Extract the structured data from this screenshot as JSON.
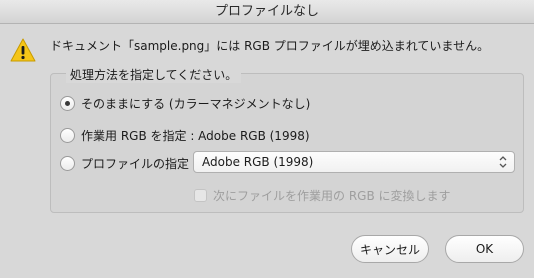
{
  "window": {
    "title": "プロファイルなし"
  },
  "message": "ドキュメント「sample.png」には RGB プロファイルが埋め込まれていません。",
  "options_group": {
    "legend": "処理方法を指定してください。",
    "options": [
      {
        "label": "そのままにする (カラーマネジメントなし)",
        "checked": true
      },
      {
        "label": "作業用 RGB を指定 : Adobe RGB (1998)",
        "checked": false
      },
      {
        "label": "プロファイルの指定 :",
        "checked": false
      }
    ],
    "profile_select": {
      "value": "Adobe RGB (1998)"
    },
    "convert_checkbox": {
      "label": "次にファイルを作業用の RGB に変換します",
      "checked": false,
      "enabled": false
    }
  },
  "buttons": {
    "cancel": "キャンセル",
    "ok": "OK"
  },
  "icons": {
    "warning": "warning-triangle-icon",
    "chevron": "chevron-updown-icon"
  },
  "colors": {
    "warning_fill": "#f5c518",
    "background": "#d8d8d8"
  }
}
